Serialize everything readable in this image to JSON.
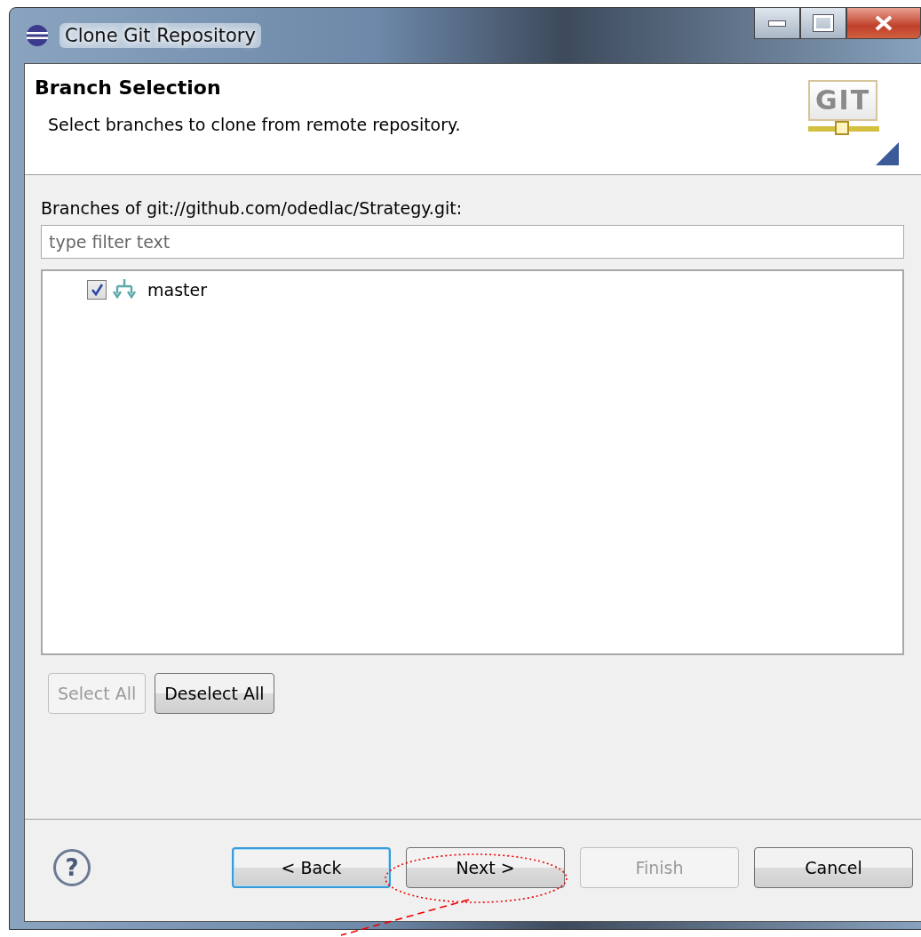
{
  "window": {
    "title": "Clone Git Repository"
  },
  "header": {
    "title": "Branch Selection",
    "description": "Select branches to clone from remote repository.",
    "logo_text": "GIT"
  },
  "branches": {
    "label": "Branches of git://github.com/odedlac/Strategy.git:",
    "filter": {
      "placeholder": "type filter text"
    },
    "items": [
      {
        "name": "master",
        "checked": true
      }
    ],
    "buttons": [
      {
        "label": "Select All",
        "disabled": true
      },
      {
        "label": "Deselect All",
        "disabled": false
      }
    ]
  },
  "footer": {
    "help": "?",
    "buttons": [
      {
        "label": "< Back",
        "disabled": false,
        "focused": true
      },
      {
        "label": "Next >",
        "disabled": false,
        "focused": false
      },
      {
        "label": "Finish",
        "disabled": true,
        "focused": false
      },
      {
        "label": "Cancel",
        "disabled": false,
        "focused": false
      }
    ]
  }
}
